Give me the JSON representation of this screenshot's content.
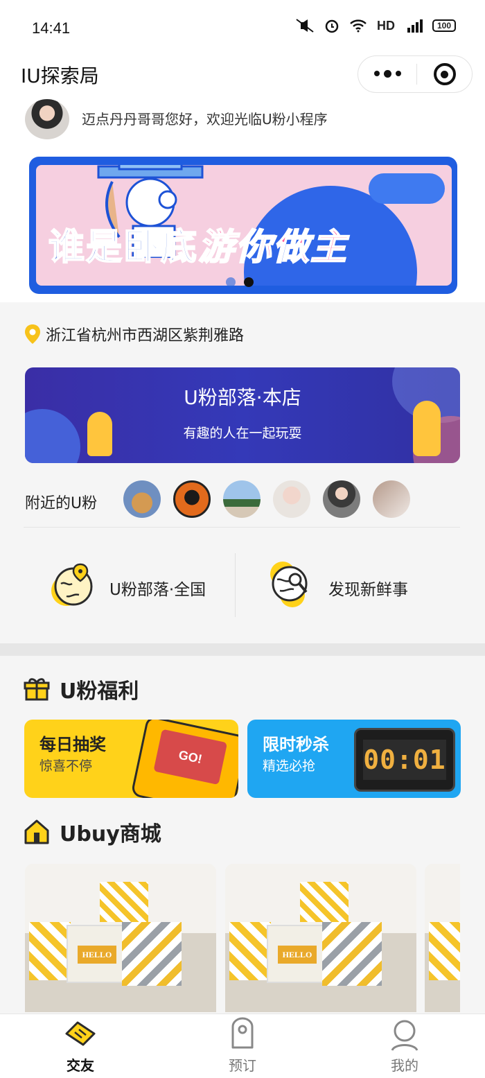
{
  "status_bar": {
    "time": "14:41",
    "network": "HD",
    "signal": "4G",
    "battery": "100"
  },
  "nav": {
    "title": "IU探索局"
  },
  "welcome": {
    "text": "迈点丹丹哥哥您好，欢迎光临U粉小程序"
  },
  "banner": {
    "text_left": "谁是卧底",
    "text_right": "游你做主",
    "active_slide": 2,
    "slide_count": 2
  },
  "location": {
    "address": "浙江省杭州市西湖区紫荆雅路"
  },
  "store": {
    "title": "U粉部落·本店",
    "subtitle": "有趣的人在一起玩耍"
  },
  "nearby": {
    "label": "附近的U粉"
  },
  "tiles": [
    {
      "label": "U粉部落·全国",
      "icon": "globe-pin-icon"
    },
    {
      "label": "发现新鲜事",
      "icon": "globe-search-icon"
    }
  ],
  "welfare": {
    "title": "U粉福利"
  },
  "promos": [
    {
      "title": "每日抽奖",
      "subtitle": "惊喜不停",
      "art_text": "GO!"
    },
    {
      "title": "限时秒杀",
      "subtitle": "精选必抢",
      "clock": "00:01"
    }
  ],
  "shop": {
    "title": "Ubuy商城",
    "product_tag": "HELLO"
  },
  "tabbar": [
    {
      "label": "交友",
      "active": true
    },
    {
      "label": "预订",
      "active": false
    },
    {
      "label": "我的",
      "active": false
    }
  ],
  "colors": {
    "accent_yellow": "#ffd21a",
    "accent_blue": "#1fa6f2",
    "store_purple": "#3439b8"
  }
}
